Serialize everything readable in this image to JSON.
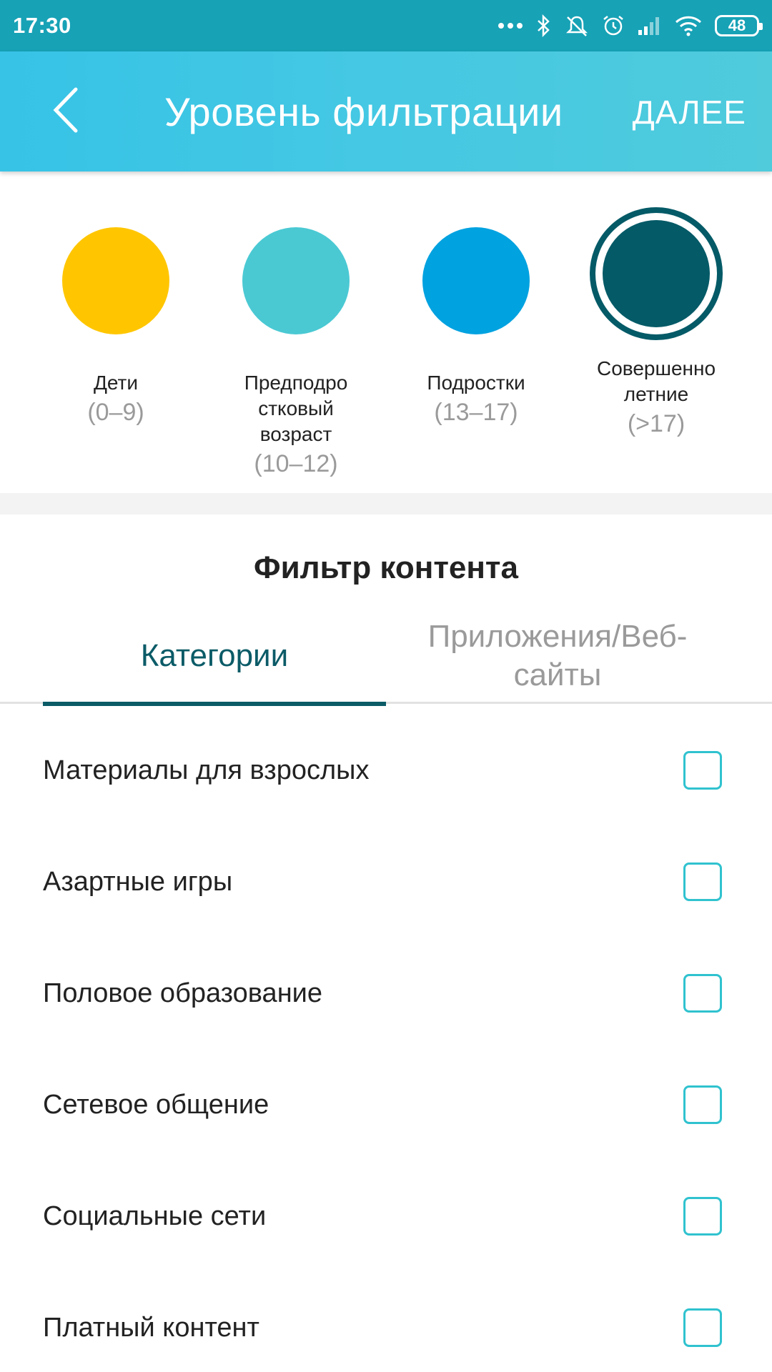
{
  "status_bar": {
    "time": "17:30",
    "battery": "48",
    "icons": [
      "more-dots-icon",
      "bluetooth-icon",
      "mute-icon",
      "alarm-icon",
      "signal-icon",
      "wifi-icon",
      "battery-icon"
    ]
  },
  "app_bar": {
    "title": "Уровень фильтрации",
    "next_label": "ДАЛЕЕ",
    "back_icon": "chevron-left-icon"
  },
  "levels": [
    {
      "name": "Дети",
      "range": "(0–9)",
      "color": "#ffc600",
      "selected": false
    },
    {
      "name": "Предподро\nстковый\nвозраст",
      "range": "(10–12)",
      "color": "#4ac9d3",
      "selected": false
    },
    {
      "name": "Подростки",
      "range": "(13–17)",
      "color": "#00a2e0",
      "selected": false
    },
    {
      "name": "Совершенно\nлетние",
      "range": "(>17)",
      "color": "#045a67",
      "selected": true
    }
  ],
  "content_filter": {
    "title": "Фильтр контента",
    "tabs": {
      "categories": "Категории",
      "apps": "Приложения/Веб-\nсайты"
    },
    "items": [
      {
        "label": "Материалы для взрослых",
        "checked": false
      },
      {
        "label": "Азартные игры",
        "checked": false
      },
      {
        "label": "Половое образование",
        "checked": false
      },
      {
        "label": "Сетевое общение",
        "checked": false
      },
      {
        "label": "Социальные сети",
        "checked": false
      },
      {
        "label": "Платный контент",
        "checked": false
      }
    ]
  },
  "colors": {
    "status_bar": "#17a2b6",
    "app_bar": "#45c8e3",
    "accent_dark": "#0b5b67",
    "checkbox_border": "#30c2cf"
  }
}
